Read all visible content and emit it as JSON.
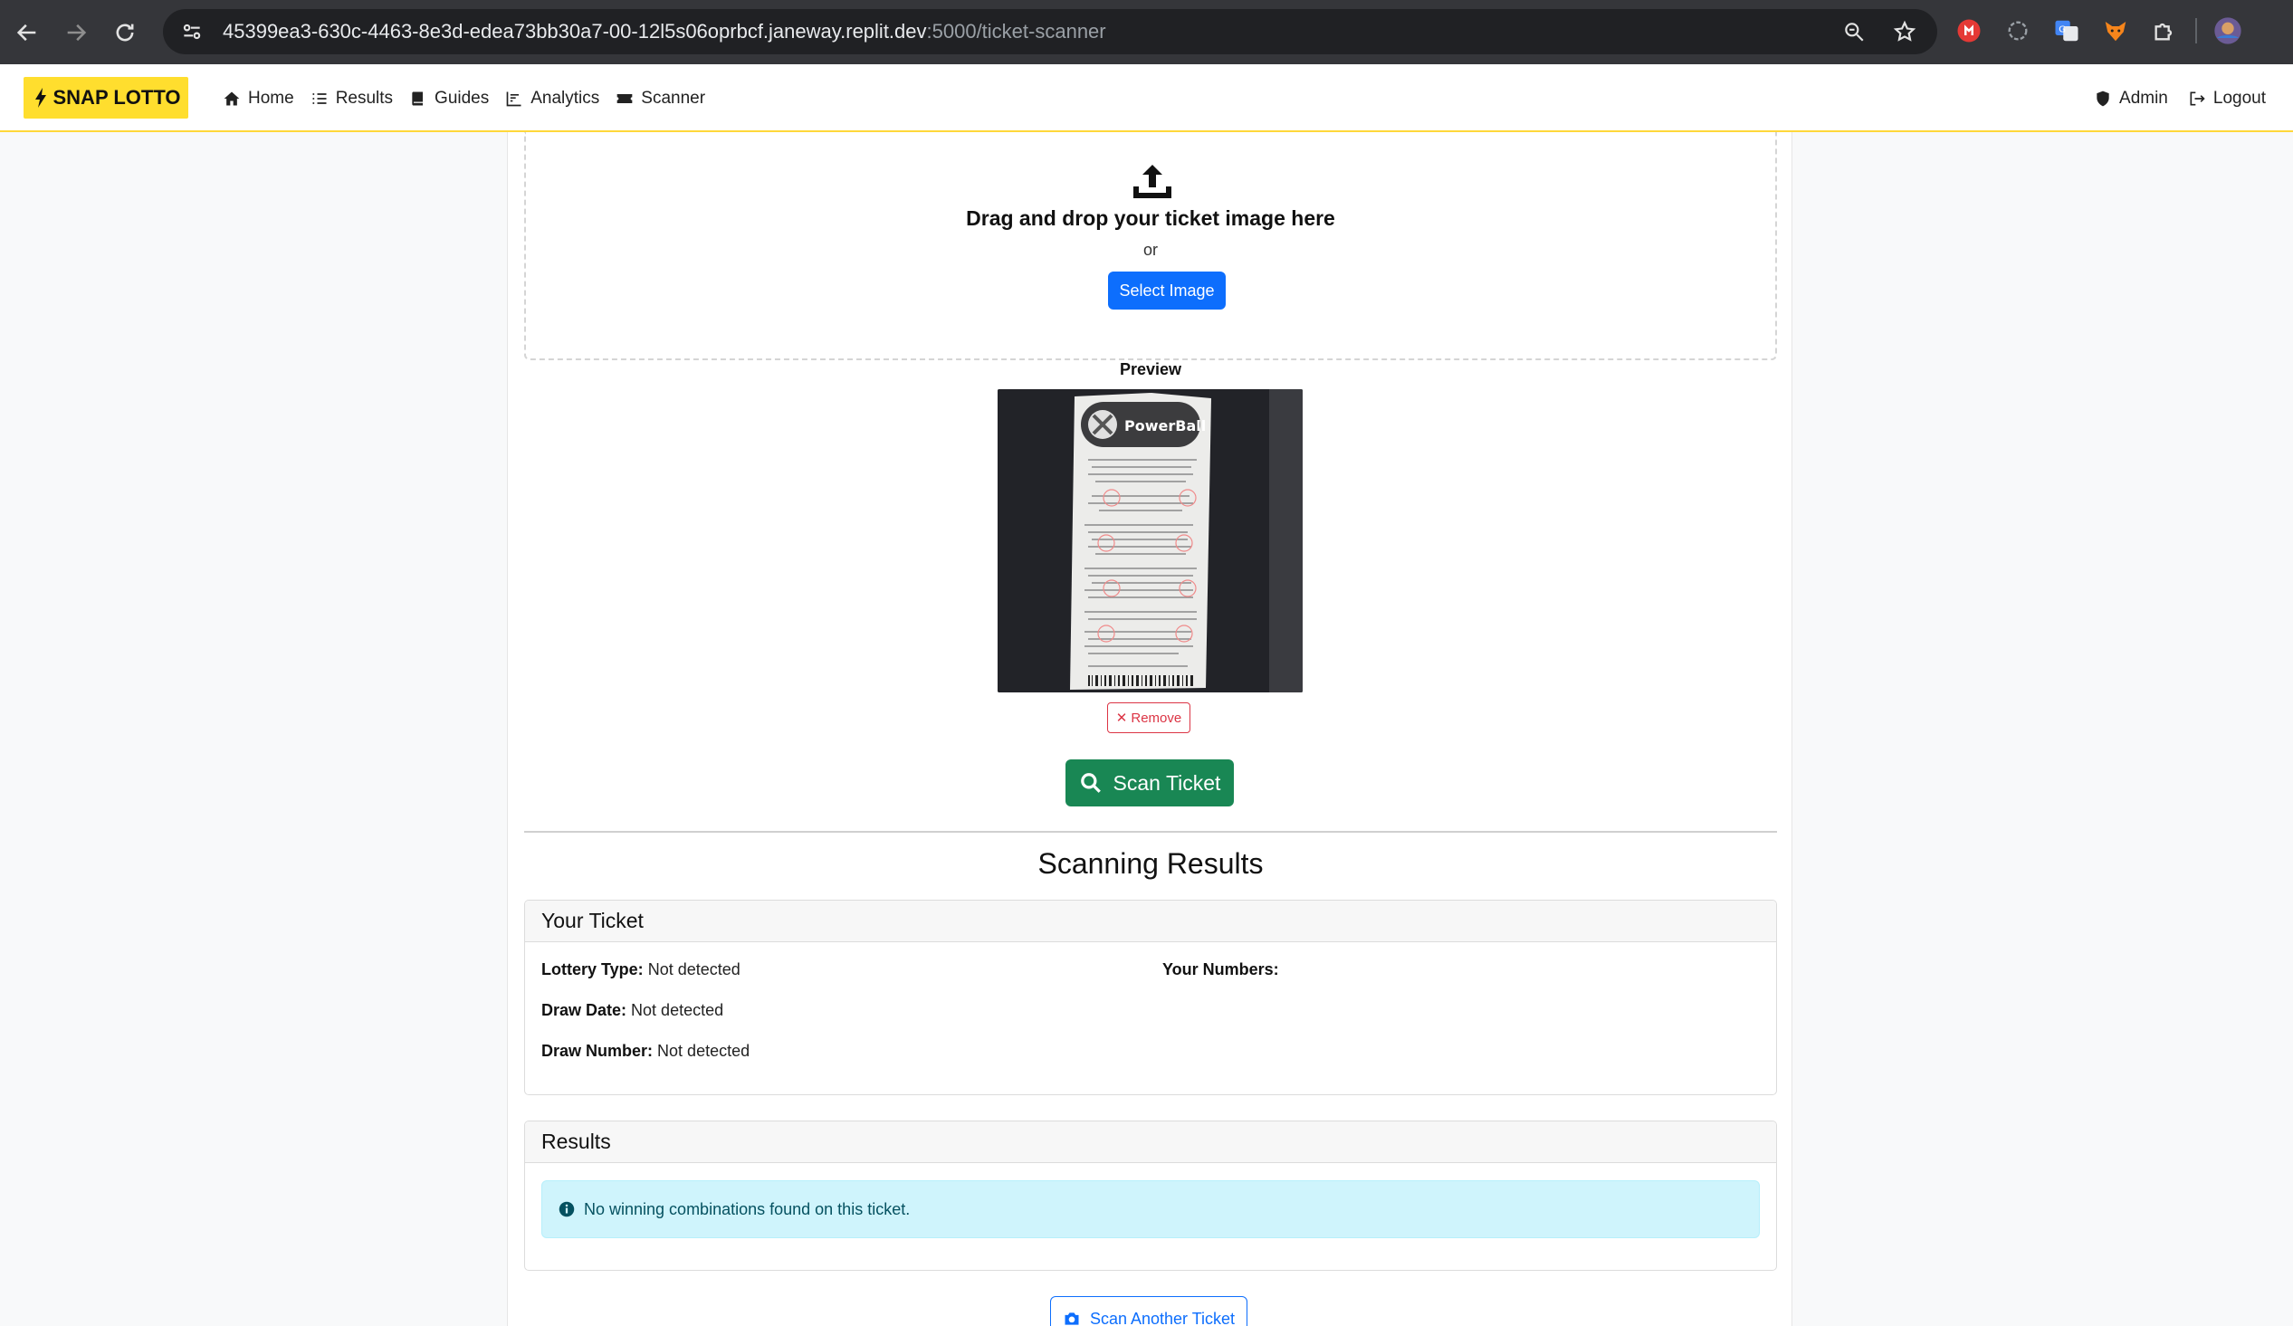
{
  "browser": {
    "url_main": "45399ea3-630c-4463-8e3d-edea73bb30a7-00-12l5s06oprbcf.janeway.replit.dev",
    "url_dim": ":5000/ticket-scanner"
  },
  "nav": {
    "brand": "SNAP LOTTO",
    "links": [
      {
        "label": "Home",
        "icon": "home-icon"
      },
      {
        "label": "Results",
        "icon": "list-icon"
      },
      {
        "label": "Guides",
        "icon": "book-icon"
      },
      {
        "label": "Analytics",
        "icon": "chart-icon"
      },
      {
        "label": "Scanner",
        "icon": "ticket-icon"
      }
    ],
    "admin": "Admin",
    "logout": "Logout"
  },
  "upload": {
    "title": "Drag and drop your ticket image here",
    "or": "or",
    "select_button": "Select Image"
  },
  "preview": {
    "label": "Preview",
    "ticket_brand": "PowerBall",
    "remove_button": "Remove"
  },
  "scan_button": "Scan Ticket",
  "results_section": {
    "title": "Scanning Results",
    "ticket_card": {
      "header": "Your Ticket",
      "lottery_type_label": "Lottery Type:",
      "lottery_type_value": "Not detected",
      "draw_date_label": "Draw Date:",
      "draw_date_value": "Not detected",
      "draw_number_label": "Draw Number:",
      "draw_number_value": "Not detected",
      "numbers_label": "Your Numbers:"
    },
    "results_card": {
      "header": "Results",
      "alert": "No winning combinations found on this ticket."
    },
    "scan_another_button": "Scan Another Ticket"
  },
  "colors": {
    "brand_yellow": "#ffde2e",
    "primary": "#0d6efd",
    "success": "#198754",
    "danger": "#dc3545",
    "info_bg": "#cff4fc"
  }
}
